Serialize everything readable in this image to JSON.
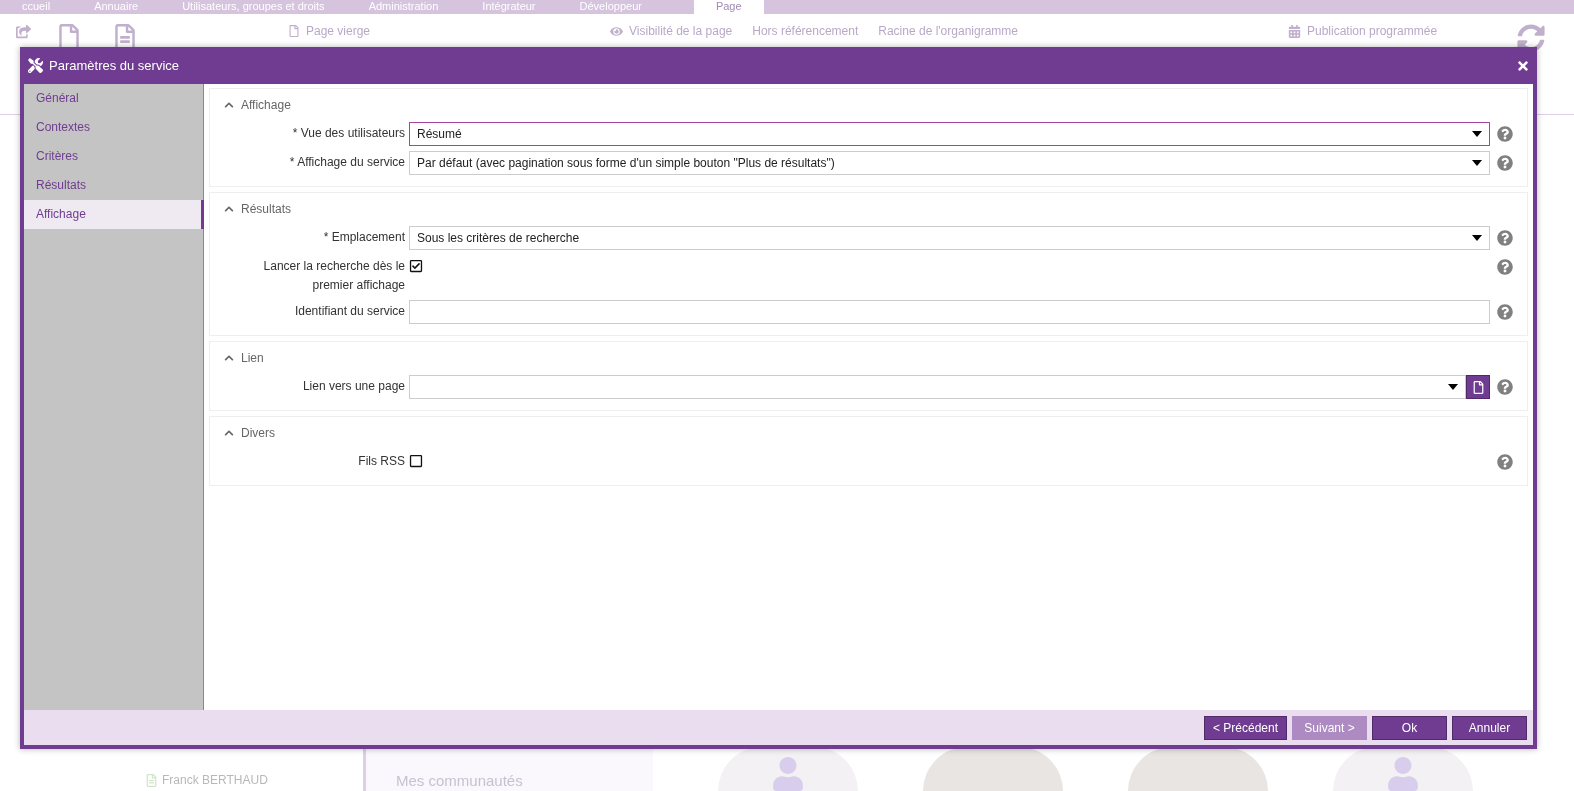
{
  "background": {
    "tabs": [
      {
        "label": "ccueil",
        "selected": false
      },
      {
        "label": "Annuaire",
        "selected": false
      },
      {
        "label": "Utilisateurs, groupes et droits",
        "selected": false
      },
      {
        "label": "Administration",
        "selected": false
      },
      {
        "label": "Intégrateur",
        "selected": false
      },
      {
        "label": "Développeur",
        "selected": false
      },
      {
        "label": "Page",
        "selected": true
      }
    ],
    "ribbon": [
      "Page vierge",
      "Visibilité de la page",
      "Hors référencement",
      "Racine de l'organigramme",
      "Publication programmée"
    ],
    "members": [
      "Franck BERTHAUD"
    ],
    "community_title": "Mes communautés"
  },
  "dialog": {
    "title": "Paramètres du service",
    "sidebar": [
      {
        "label": "Général",
        "selected": false
      },
      {
        "label": "Contextes",
        "selected": false
      },
      {
        "label": "Critères",
        "selected": false
      },
      {
        "label": "Résultats",
        "selected": false
      },
      {
        "label": "Affichage",
        "selected": true
      }
    ],
    "sections": [
      {
        "title": "Affichage",
        "expanded": true,
        "fields": [
          {
            "kind": "select",
            "label": "* Vue des utilisateurs",
            "value": "Résumé",
            "focused": true
          },
          {
            "kind": "select",
            "label": "* Affichage du service",
            "value": "Par défaut (avec pagination sous forme d'un simple bouton \"Plus de résultats\")",
            "focused": false
          }
        ]
      },
      {
        "title": "Résultats",
        "expanded": true,
        "fields": [
          {
            "kind": "select",
            "label": "* Emplacement",
            "value": "Sous les critères de recherche",
            "focused": false
          },
          {
            "kind": "checkbox",
            "label": "Lancer la recherche dès le premier affichage",
            "checked": true
          },
          {
            "kind": "text",
            "label": "Identifiant du service",
            "focused": false
          }
        ]
      },
      {
        "title": "Lien",
        "expanded": true,
        "fields": [
          {
            "kind": "page",
            "label": "Lien vers une page",
            "focused": false
          }
        ]
      },
      {
        "title": "Divers",
        "expanded": true,
        "fields": [
          {
            "kind": "checkbox",
            "label": "Fils RSS",
            "checked": false
          }
        ]
      }
    ],
    "buttons": [
      {
        "label": "< Précédent",
        "disabled": false
      },
      {
        "label": "Suivant >",
        "disabled": true
      },
      {
        "label": "Ok",
        "disabled": false
      },
      {
        "label": "Annuler",
        "disabled": false
      }
    ]
  }
}
